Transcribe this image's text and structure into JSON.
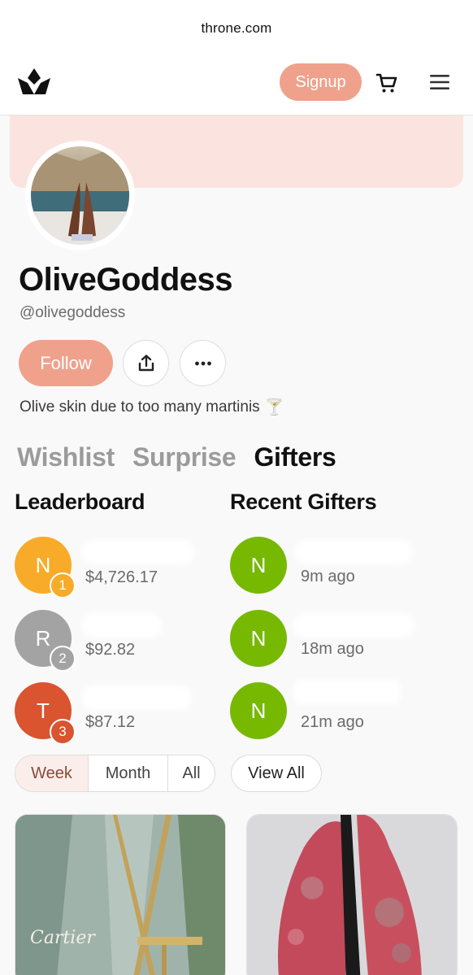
{
  "browser": {
    "url": "throne.com"
  },
  "nav": {
    "signup_label": "Signup"
  },
  "profile": {
    "name": "OliveGoddess",
    "handle": "@olivegoddess",
    "follow_label": "Follow",
    "bio": "Olive skin due to too many martinis",
    "bio_emoji": "🍸"
  },
  "tabs": [
    {
      "label": "Wishlist",
      "active": false
    },
    {
      "label": "Surprise",
      "active": false
    },
    {
      "label": "Gifters",
      "active": true
    }
  ],
  "leaderboard": {
    "title": "Leaderboard",
    "entries": [
      {
        "initial": "N",
        "rank": "1",
        "amount": "$4,726.17",
        "color": "#f8ab28"
      },
      {
        "initial": "R",
        "rank": "2",
        "amount": "$92.82",
        "color": "#a3a3a3"
      },
      {
        "initial": "T",
        "rank": "3",
        "amount": "$87.12",
        "color": "#d9542f"
      }
    ],
    "periods": [
      {
        "label": "Week",
        "active": true
      },
      {
        "label": "Month",
        "active": false
      },
      {
        "label": "All",
        "active": false
      }
    ]
  },
  "recent": {
    "title": "Recent Gifters",
    "entries": [
      {
        "initial": "N",
        "time": "9m ago",
        "color": "#76b900"
      },
      {
        "initial": "N",
        "time": "18m ago",
        "color": "#76b900"
      },
      {
        "initial": "N",
        "time": "21m ago",
        "color": "#76b900"
      }
    ],
    "view_all_label": "View All"
  },
  "wishlist_preview": {
    "card1_caption": "Cartier"
  },
  "colors": {
    "accent": "#f0a18c",
    "banner": "#fbe4df"
  }
}
